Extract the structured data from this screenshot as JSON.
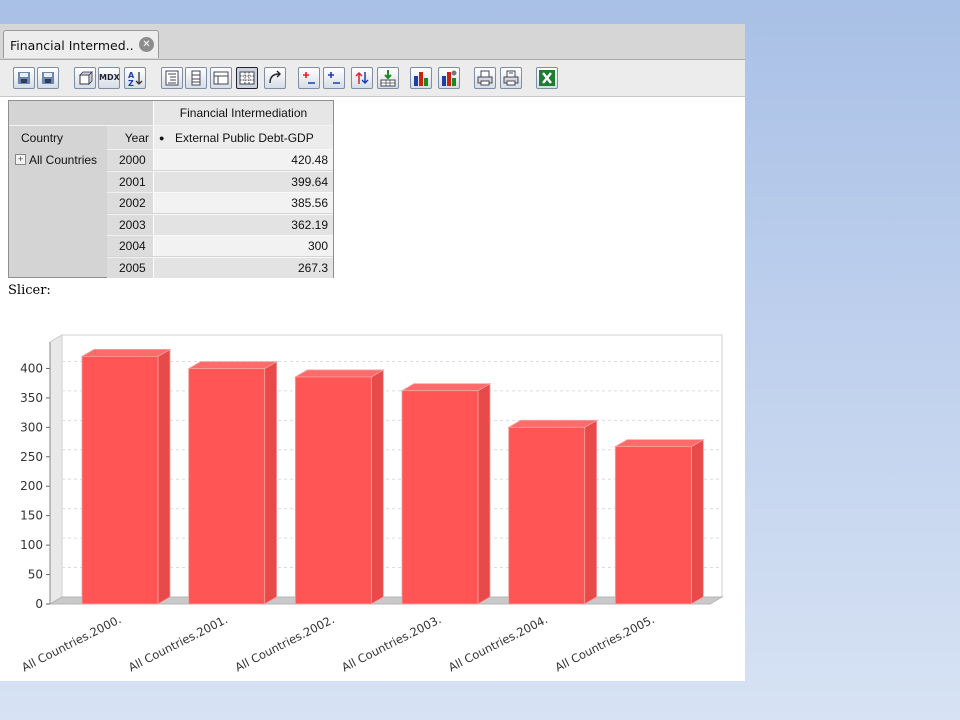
{
  "tab": {
    "label": "Financial Intermed.."
  },
  "toolbar": {
    "buttons": [
      {
        "name": "save-icon",
        "label": ""
      },
      {
        "name": "save-as-icon",
        "label": ""
      },
      {
        "name": "cube-navigator-icon",
        "label": ""
      },
      {
        "name": "mdx-icon",
        "label": "MDX"
      },
      {
        "name": "sort-az-icon",
        "label": ""
      },
      {
        "name": "show-parent-members-icon",
        "label": ""
      },
      {
        "name": "hide-spans-icon",
        "label": ""
      },
      {
        "name": "show-properties-icon",
        "label": ""
      },
      {
        "name": "suppress-empty-icon",
        "label": ""
      },
      {
        "name": "swap-axes-icon",
        "label": ""
      },
      {
        "name": "drill-member-icon",
        "label": ""
      },
      {
        "name": "drill-position-icon",
        "label": ""
      },
      {
        "name": "drill-replace-icon",
        "label": ""
      },
      {
        "name": "drill-through-icon",
        "label": ""
      },
      {
        "name": "show-chart-icon",
        "label": ""
      },
      {
        "name": "chart-config-icon",
        "label": ""
      },
      {
        "name": "print-icon",
        "label": ""
      },
      {
        "name": "print-config-icon",
        "label": ""
      },
      {
        "name": "excel-export-icon",
        "label": ""
      }
    ]
  },
  "pivot": {
    "measure_group": "Financial Intermediation",
    "country_header": "Country",
    "year_header": "Year",
    "measure_bullet": "●",
    "measure": "External Public Debt-GDP",
    "expand_marker": "+",
    "country": "All Countries",
    "rows": [
      {
        "year": "2000",
        "value": "420.48"
      },
      {
        "year": "2001",
        "value": "399.64"
      },
      {
        "year": "2002",
        "value": "385.56"
      },
      {
        "year": "2003",
        "value": "362.19"
      },
      {
        "year": "2004",
        "value": "300"
      },
      {
        "year": "2005",
        "value": "267.3"
      }
    ]
  },
  "slicer": {
    "label": "Slicer:"
  },
  "chart_data": {
    "type": "bar",
    "title": "",
    "xlabel": "",
    "ylabel": "",
    "categories": [
      "All Countries.2000.",
      "All Countries.2001.",
      "All Countries.2002.",
      "All Countries.2003.",
      "All Countries.2004.",
      "All Countries.2005."
    ],
    "values": [
      420.48,
      399.64,
      385.56,
      362.19,
      300,
      267.3
    ],
    "yticks": [
      0,
      50,
      100,
      150,
      200,
      250,
      300,
      350,
      400
    ],
    "ylim": [
      0,
      450
    ],
    "grid": true,
    "bar_color": "#ff5555",
    "style": "3d"
  }
}
